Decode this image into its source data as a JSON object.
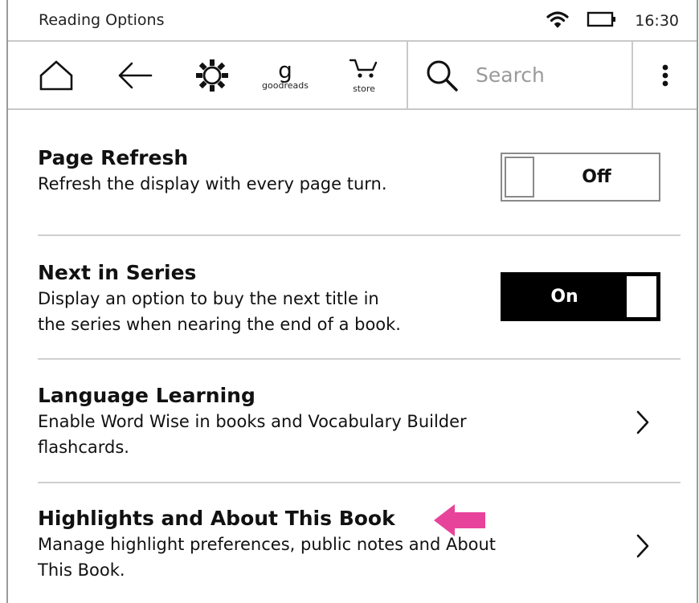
{
  "status_bar": {
    "title": "Reading Options",
    "time": "16:30",
    "wifi_icon": "wifi-icon",
    "battery_icon": "battery-icon"
  },
  "toolbar": {
    "home_icon": "home-icon",
    "back_icon": "back-arrow-icon",
    "settings_icon": "gear-icon",
    "goodreads_letter": "g",
    "goodreads_label": "goodreads",
    "store_label": "store",
    "search_placeholder": "Search",
    "menu_icon": "more-vertical-icon"
  },
  "settings": [
    {
      "title": "Page Refresh",
      "description": "Refresh the display with every page turn.",
      "control": "toggle",
      "state": "Off"
    },
    {
      "title": "Next in Series",
      "description_line1": "Display an option to buy the next title in",
      "description_line2": "the series when nearing the end of a book.",
      "control": "toggle",
      "state": "On"
    },
    {
      "title": "Language Learning",
      "description_line1": "Enable Word Wise in books and Vocabulary Builder",
      "description_line2": "flashcards.",
      "control": "chevron"
    },
    {
      "title": "Highlights and About This Book",
      "description_line1": "Manage highlight preferences, public notes and About",
      "description_line2": "This Book.",
      "control": "chevron"
    }
  ],
  "annotation": {
    "arrow_color": "#e8439a",
    "icon": "pointer-arrow-icon"
  },
  "colors": {
    "toggle_on_bg": "#000000",
    "divider": "#d0d0d0",
    "search_placeholder": "#9a9a9a"
  }
}
